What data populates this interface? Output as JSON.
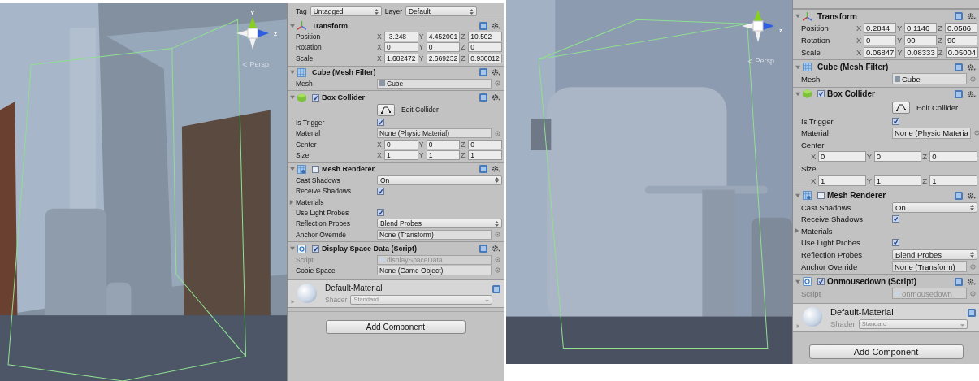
{
  "panels": [
    {
      "scene": {
        "y_label": "y",
        "z_label": "z",
        "view_label": "Persp"
      },
      "inspector": {
        "tag_row": {
          "tag_label": "Tag",
          "tag": "Untagged",
          "layer_label": "Layer",
          "layer": "Default"
        },
        "components": [
          {
            "title": "Transform",
            "kind": "transform",
            "expanded": true,
            "rows": [
              {
                "kind": "vector3",
                "label": "Position",
                "fields": [
                  {
                    "axis": "X",
                    "value": "-3.248"
                  },
                  {
                    "axis": "Y",
                    "value": "4.452001"
                  },
                  {
                    "axis": "Z",
                    "value": "10.502"
                  }
                ]
              },
              {
                "kind": "vector3",
                "label": "Rotation",
                "fields": [
                  {
                    "axis": "X",
                    "value": "0"
                  },
                  {
                    "axis": "Y",
                    "value": "0"
                  },
                  {
                    "axis": "Z",
                    "value": "0"
                  }
                ]
              },
              {
                "kind": "vector3",
                "label": "Scale",
                "fields": [
                  {
                    "axis": "X",
                    "value": "1.682472"
                  },
                  {
                    "axis": "Y",
                    "value": "2.669232"
                  },
                  {
                    "axis": "Z",
                    "value": "0.930012"
                  }
                ]
              }
            ]
          },
          {
            "title": "Cube (Mesh Filter)",
            "kind": "mesh",
            "expanded": true,
            "rows": [
              {
                "kind": "object",
                "label": "Mesh",
                "value": "Cube",
                "disabled": false
              }
            ]
          },
          {
            "title": "Box Collider",
            "kind": "collider",
            "expanded": true,
            "enabled": true,
            "rows": [
              {
                "kind": "edit_button",
                "label": "Edit Collider"
              },
              {
                "kind": "checkbox",
                "label": "Is Trigger",
                "checked": true
              },
              {
                "kind": "object",
                "label": "Material",
                "value": "None (Physic Material)",
                "disabled": false
              },
              {
                "kind": "vector3",
                "label": "Center",
                "fields": [
                  {
                    "axis": "X",
                    "value": "0"
                  },
                  {
                    "axis": "Y",
                    "value": "0"
                  },
                  {
                    "axis": "Z",
                    "value": "0"
                  }
                ]
              },
              {
                "kind": "vector3",
                "label": "Size",
                "fields": [
                  {
                    "axis": "X",
                    "value": "1"
                  },
                  {
                    "axis": "Y",
                    "value": "1"
                  },
                  {
                    "axis": "Z",
                    "value": "1"
                  }
                ]
              }
            ]
          },
          {
            "title": "Mesh Renderer",
            "kind": "renderer",
            "expanded": true,
            "enabled": false,
            "rows": [
              {
                "kind": "dropdown",
                "label": "Cast Shadows",
                "value": "On"
              },
              {
                "kind": "checkbox",
                "label": "Receive Shadows",
                "checked": true
              },
              {
                "kind": "foldout",
                "label": "Materials",
                "expanded": false
              },
              {
                "kind": "checkbox",
                "label": "Use Light Probes",
                "checked": true
              },
              {
                "kind": "dropdown",
                "label": "Reflection Probes",
                "value": "Blend Probes"
              },
              {
                "kind": "object",
                "label": "Anchor Override",
                "value": "None (Transform)",
                "disabled": false
              }
            ]
          },
          {
            "title": "Display Space Data (Script)",
            "kind": "script",
            "expanded": true,
            "enabled": true,
            "rows": [
              {
                "kind": "object",
                "label": "Script",
                "value": "displaySpaceData",
                "disabled": true
              },
              {
                "kind": "object",
                "label": "Cobie Space",
                "value": "None (Game Object)",
                "disabled": false
              }
            ]
          }
        ],
        "material": {
          "name": "Default-Material",
          "shader_label": "Shader",
          "shader": "Standard"
        },
        "add_button": "Add Component"
      }
    },
    {
      "scene": {
        "z_label": "z",
        "view_label": "Persp"
      },
      "inspector": {
        "components": [
          {
            "title": "Transform",
            "kind": "transform",
            "expanded": true,
            "rows": [
              {
                "kind": "vector3",
                "label": "Position",
                "fields": [
                  {
                    "axis": "X",
                    "value": "0.2844"
                  },
                  {
                    "axis": "Y",
                    "value": "0.1146"
                  },
                  {
                    "axis": "Z",
                    "value": "0.0586"
                  }
                ]
              },
              {
                "kind": "vector3",
                "label": "Rotation",
                "fields": [
                  {
                    "axis": "X",
                    "value": "0"
                  },
                  {
                    "axis": "Y",
                    "value": "90"
                  },
                  {
                    "axis": "Z",
                    "value": "90"
                  }
                ]
              },
              {
                "kind": "vector3",
                "label": "Scale",
                "fields": [
                  {
                    "axis": "X",
                    "value": "0.06847"
                  },
                  {
                    "axis": "Y",
                    "value": "0.08333"
                  },
                  {
                    "axis": "Z",
                    "value": "0.05004"
                  }
                ]
              }
            ]
          },
          {
            "title": "Cube (Mesh Filter)",
            "kind": "mesh",
            "expanded": true,
            "rows": [
              {
                "kind": "object",
                "label": "Mesh",
                "value": "Cube",
                "disabled": false
              }
            ]
          },
          {
            "title": "Box Collider",
            "kind": "collider",
            "expanded": true,
            "enabled": true,
            "rows": [
              {
                "kind": "edit_button",
                "label": "Edit Collider"
              },
              {
                "kind": "checkbox",
                "label": "Is Trigger",
                "checked": true
              },
              {
                "kind": "object",
                "label": "Material",
                "value": "None (Physic Materia",
                "disabled": false
              },
              {
                "kind": "vector3_stacked",
                "label": "Center",
                "fields": [
                  {
                    "axis": "X",
                    "value": "0"
                  },
                  {
                    "axis": "Y",
                    "value": "0"
                  },
                  {
                    "axis": "Z",
                    "value": "0"
                  }
                ]
              },
              {
                "kind": "vector3_stacked",
                "label": "Size",
                "fields": [
                  {
                    "axis": "X",
                    "value": "1"
                  },
                  {
                    "axis": "Y",
                    "value": "1"
                  },
                  {
                    "axis": "Z",
                    "value": "1"
                  }
                ]
              }
            ]
          },
          {
            "title": "Mesh Renderer",
            "kind": "renderer",
            "expanded": true,
            "enabled": false,
            "rows": [
              {
                "kind": "dropdown",
                "label": "Cast Shadows",
                "value": "On"
              },
              {
                "kind": "checkbox",
                "label": "Receive Shadows",
                "checked": true
              },
              {
                "kind": "foldout",
                "label": "Materials",
                "expanded": false
              },
              {
                "kind": "checkbox",
                "label": "Use Light Probes",
                "checked": true
              },
              {
                "kind": "dropdown",
                "label": "Reflection Probes",
                "value": "Blend Probes"
              },
              {
                "kind": "object",
                "label": "Anchor Override",
                "value": "None (Transform)",
                "disabled": false
              }
            ]
          },
          {
            "title": "Onmousedown (Script)",
            "kind": "script",
            "expanded": true,
            "enabled": true,
            "rows": [
              {
                "kind": "object",
                "label": "Script",
                "value": "onmousedown",
                "disabled": true
              }
            ]
          }
        ],
        "material": {
          "name": "Default-Material",
          "shader_label": "Shader",
          "shader": "Standard"
        },
        "add_button": "Add Component"
      }
    }
  ]
}
